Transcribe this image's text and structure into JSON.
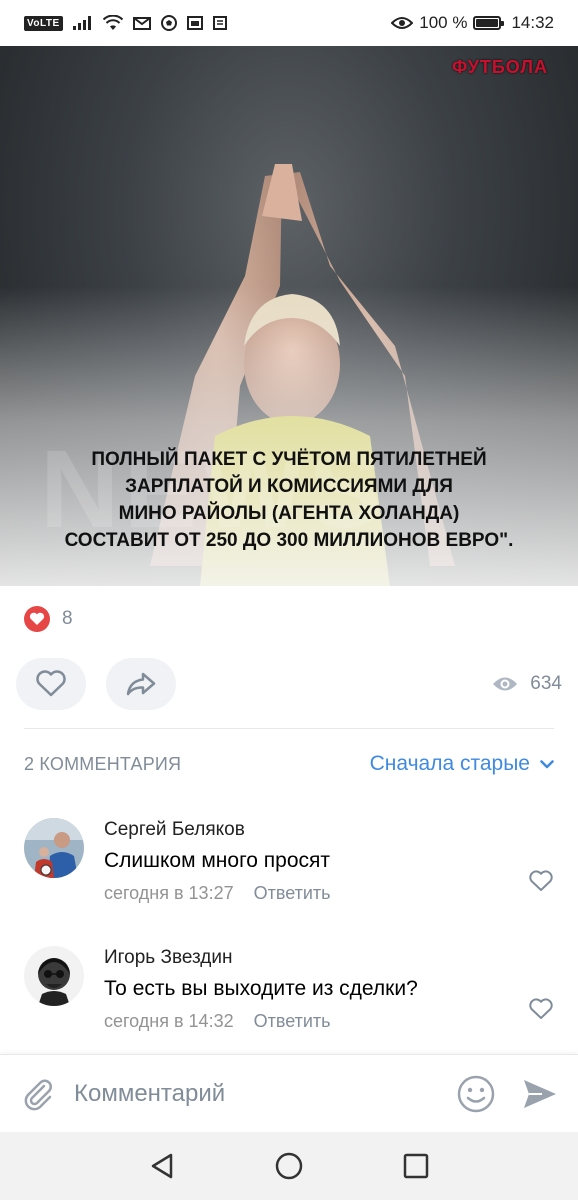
{
  "status_bar": {
    "network_label": "VoLTE",
    "battery_text": "100 %",
    "battery_level": 1.0,
    "time": "14:32"
  },
  "post": {
    "brand": "ФУТБОЛА",
    "watermark": "NEWS",
    "caption_lines": [
      "ПОЛНЫЙ ПАКЕТ С УЧЁТОМ ПЯТИЛЕТНЕЙ",
      "ЗАРПЛАТОЙ И КОМИССИЯМИ ДЛЯ",
      "МИНО РАЙОЛЫ (АГЕНТА ХОЛАНДА)",
      "СОСТАВИТ ОТ 250 ДО 300 МИЛЛИОНОВ ЕВРО\"."
    ],
    "likes_count": "8",
    "views_count": "634"
  },
  "comments_section": {
    "count_label": "2 комментария",
    "sort_label": "Сначала старые",
    "items": [
      {
        "author": "Сергей Беляков",
        "text": "Слишком много просят",
        "time": "сегодня в 13:27",
        "reply_label": "Ответить"
      },
      {
        "author": "Игорь Звездин",
        "text": "То есть вы выходите из сделки?",
        "time": "сегодня в 14:32",
        "reply_label": "Ответить"
      }
    ]
  },
  "composer": {
    "placeholder": "Комментарий"
  },
  "colors": {
    "accent": "#3f8ae0",
    "like_red": "#e64646",
    "secondary_text": "#818c99"
  }
}
